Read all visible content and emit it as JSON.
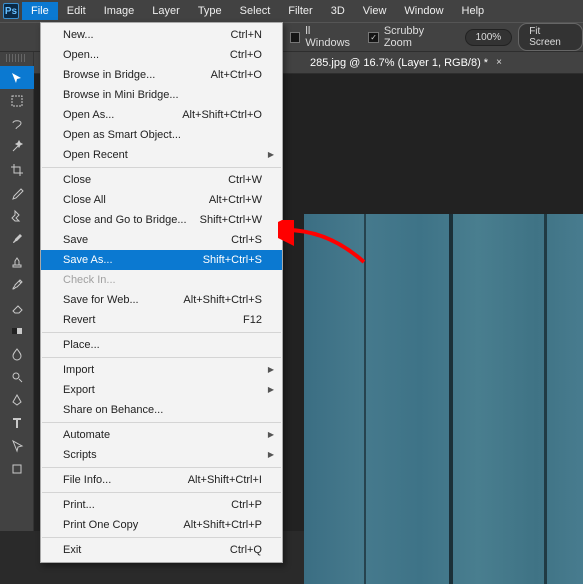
{
  "app": {
    "logo": "Ps"
  },
  "menus": {
    "file": "File",
    "edit": "Edit",
    "image": "Image",
    "layer": "Layer",
    "type": "Type",
    "select": "Select",
    "filter": "Filter",
    "threeD": "3D",
    "view": "View",
    "window": "Window",
    "help": "Help"
  },
  "options": {
    "allWindows": "ll Windows",
    "scrubby": "Scrubby Zoom",
    "zoomLevel": "100%",
    "fitScreen": "Fit Screen"
  },
  "tab": {
    "title": "285.jpg @ 16.7% (Layer 1, RGB/8) *",
    "close": "×"
  },
  "fileMenu": [
    {
      "label": "New...",
      "shortcut": "Ctrl+N"
    },
    {
      "label": "Open...",
      "shortcut": "Ctrl+O"
    },
    {
      "label": "Browse in Bridge...",
      "shortcut": "Alt+Ctrl+O"
    },
    {
      "label": "Browse in Mini Bridge..."
    },
    {
      "label": "Open As...",
      "shortcut": "Alt+Shift+Ctrl+O"
    },
    {
      "label": "Open as Smart Object..."
    },
    {
      "label": "Open Recent",
      "sub": true
    },
    {
      "sep": true
    },
    {
      "label": "Close",
      "shortcut": "Ctrl+W"
    },
    {
      "label": "Close All",
      "shortcut": "Alt+Ctrl+W"
    },
    {
      "label": "Close and Go to Bridge...",
      "shortcut": "Shift+Ctrl+W"
    },
    {
      "label": "Save",
      "shortcut": "Ctrl+S"
    },
    {
      "label": "Save As...",
      "shortcut": "Shift+Ctrl+S",
      "highlight": true
    },
    {
      "label": "Check In...",
      "disabled": true
    },
    {
      "label": "Save for Web...",
      "shortcut": "Alt+Shift+Ctrl+S"
    },
    {
      "label": "Revert",
      "shortcut": "F12"
    },
    {
      "sep": true
    },
    {
      "label": "Place..."
    },
    {
      "sep": true
    },
    {
      "label": "Import",
      "sub": true
    },
    {
      "label": "Export",
      "sub": true
    },
    {
      "label": "Share on Behance..."
    },
    {
      "sep": true
    },
    {
      "label": "Automate",
      "sub": true
    },
    {
      "label": "Scripts",
      "sub": true
    },
    {
      "sep": true
    },
    {
      "label": "File Info...",
      "shortcut": "Alt+Shift+Ctrl+I"
    },
    {
      "sep": true
    },
    {
      "label": "Print...",
      "shortcut": "Ctrl+P"
    },
    {
      "label": "Print One Copy",
      "shortcut": "Alt+Shift+Ctrl+P"
    },
    {
      "sep": true
    },
    {
      "label": "Exit",
      "shortcut": "Ctrl+Q"
    }
  ],
  "tools": [
    "move-tool",
    "marquee-tool",
    "lasso-tool",
    "magic-wand-tool",
    "crop-tool",
    "eyedropper-tool",
    "healing-brush-tool",
    "brush-tool",
    "clone-stamp-tool",
    "history-brush-tool",
    "eraser-tool",
    "gradient-tool",
    "blur-tool",
    "dodge-tool",
    "pen-tool",
    "type-tool",
    "path-selection-tool",
    "rectangle-tool"
  ]
}
